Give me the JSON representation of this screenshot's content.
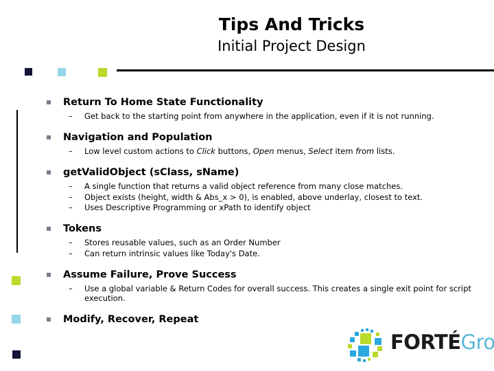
{
  "header": {
    "title": "Tips And Tricks",
    "subtitle": "Initial Project Design"
  },
  "colors": {
    "navy": "#151539",
    "light_blue": "#96d6e8",
    "green": "#bada2c",
    "logo_blue": "#29a8e0",
    "logo_green": "#bada2c",
    "logo_group_text": "#5bb7d6",
    "bullet_marker": "#7c7c8c",
    "rule": "#000000"
  },
  "content": {
    "groups": [
      {
        "heading": "Return To Home State Functionality",
        "subs": [
          {
            "text": "Get back to the starting point from anywhere in the application, even if it is not running."
          }
        ]
      },
      {
        "heading": "Navigation and Population",
        "subs": [
          {
            "rich": [
              {
                "text": "Low level custom actions to ",
                "italic": false
              },
              {
                "text": "Click",
                "italic": true
              },
              {
                "text": " buttons, ",
                "italic": false
              },
              {
                "text": "Open",
                "italic": true
              },
              {
                "text": " menus, ",
                "italic": false
              },
              {
                "text": "Select",
                "italic": true
              },
              {
                "text": " item ",
                "italic": false
              },
              {
                "text": "from",
                "italic": true
              },
              {
                "text": " lists.",
                "italic": false
              }
            ]
          }
        ]
      },
      {
        "heading": "getValidObject (sClass, sName)",
        "subs": [
          {
            "text": "A single function that returns a valid object reference from many close matches."
          },
          {
            "text": "Object exists (height, width & Abs_x > 0), is enabled, above underlay, closest to text."
          },
          {
            "text": "Uses Descriptive Programming or xPath to identify object"
          }
        ]
      },
      {
        "heading": "Tokens",
        "subs": [
          {
            "text": "Stores reusable values, such as an Order Number"
          },
          {
            "text": "Can return intrinsic values like Today's Date."
          }
        ]
      },
      {
        "heading": "Assume Failure, Prove Success",
        "subs": [
          {
            "text": "Use a global variable & Return Codes for overall success. This creates a single exit point for script execution."
          }
        ]
      },
      {
        "heading": "Modify, Recover, Repeat",
        "subs": []
      }
    ],
    "sub_marker": "–"
  },
  "logo": {
    "name_bold": "FORTÉ",
    "name_light": "Group"
  }
}
